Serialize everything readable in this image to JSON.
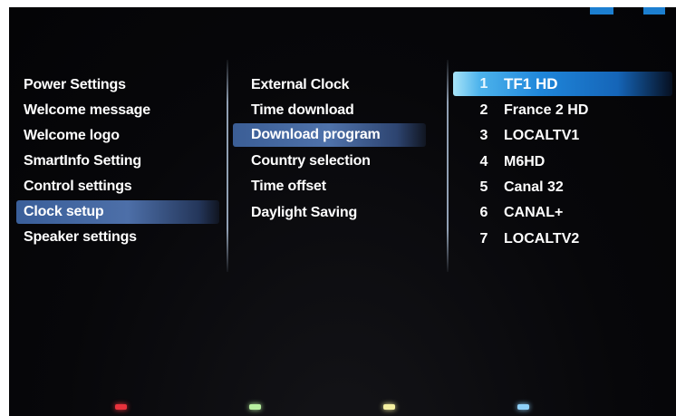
{
  "left_menu": {
    "items": [
      {
        "label": "Power Settings"
      },
      {
        "label": "Welcome message"
      },
      {
        "label": "Welcome logo"
      },
      {
        "label": "SmartInfo Setting"
      },
      {
        "label": "Control settings"
      },
      {
        "label": "Clock setup"
      },
      {
        "label": "Speaker settings"
      }
    ],
    "selected": "Clock setup"
  },
  "clock_menu": {
    "items": [
      {
        "label": "External Clock"
      },
      {
        "label": "Time download"
      },
      {
        "label": "Download program"
      },
      {
        "label": "Country selection"
      },
      {
        "label": "Time offset"
      },
      {
        "label": "Daylight Saving"
      }
    ],
    "selected": "Download program"
  },
  "channel_list": {
    "items": [
      {
        "number": "1",
        "name": "TF1 HD"
      },
      {
        "number": "2",
        "name": "France 2 HD"
      },
      {
        "number": "3",
        "name": "LOCALTV1"
      },
      {
        "number": "4",
        "name": "M6HD"
      },
      {
        "number": "5",
        "name": "Canal 32"
      },
      {
        "number": "6",
        "name": "CANAL+"
      },
      {
        "number": "7",
        "name": "LOCALTV2"
      }
    ],
    "selected": "TF1 HD"
  },
  "color_keys": {
    "red": "#e8323c",
    "green": "#b8f0a0",
    "yellow": "#f4f0a0",
    "blue": "#8ed0f8"
  },
  "accent_color": "#1f86da"
}
